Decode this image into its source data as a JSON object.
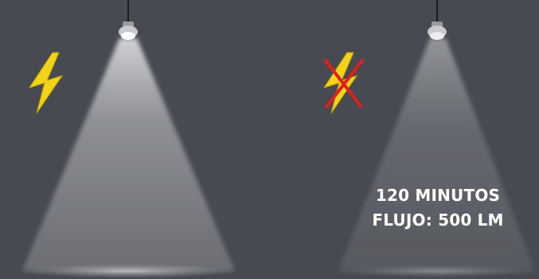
{
  "caption": {
    "duration": "120 MINUTOS",
    "flux": "FLUJO: 500 LM"
  },
  "icons": {
    "left_power": "lightning-bolt-icon",
    "right_power": "lightning-bolt-crossed-icon"
  },
  "colors": {
    "background": "#474a50",
    "bolt": "#f3d21c",
    "cross": "#e0201e",
    "caption_text": "#ffffff"
  }
}
